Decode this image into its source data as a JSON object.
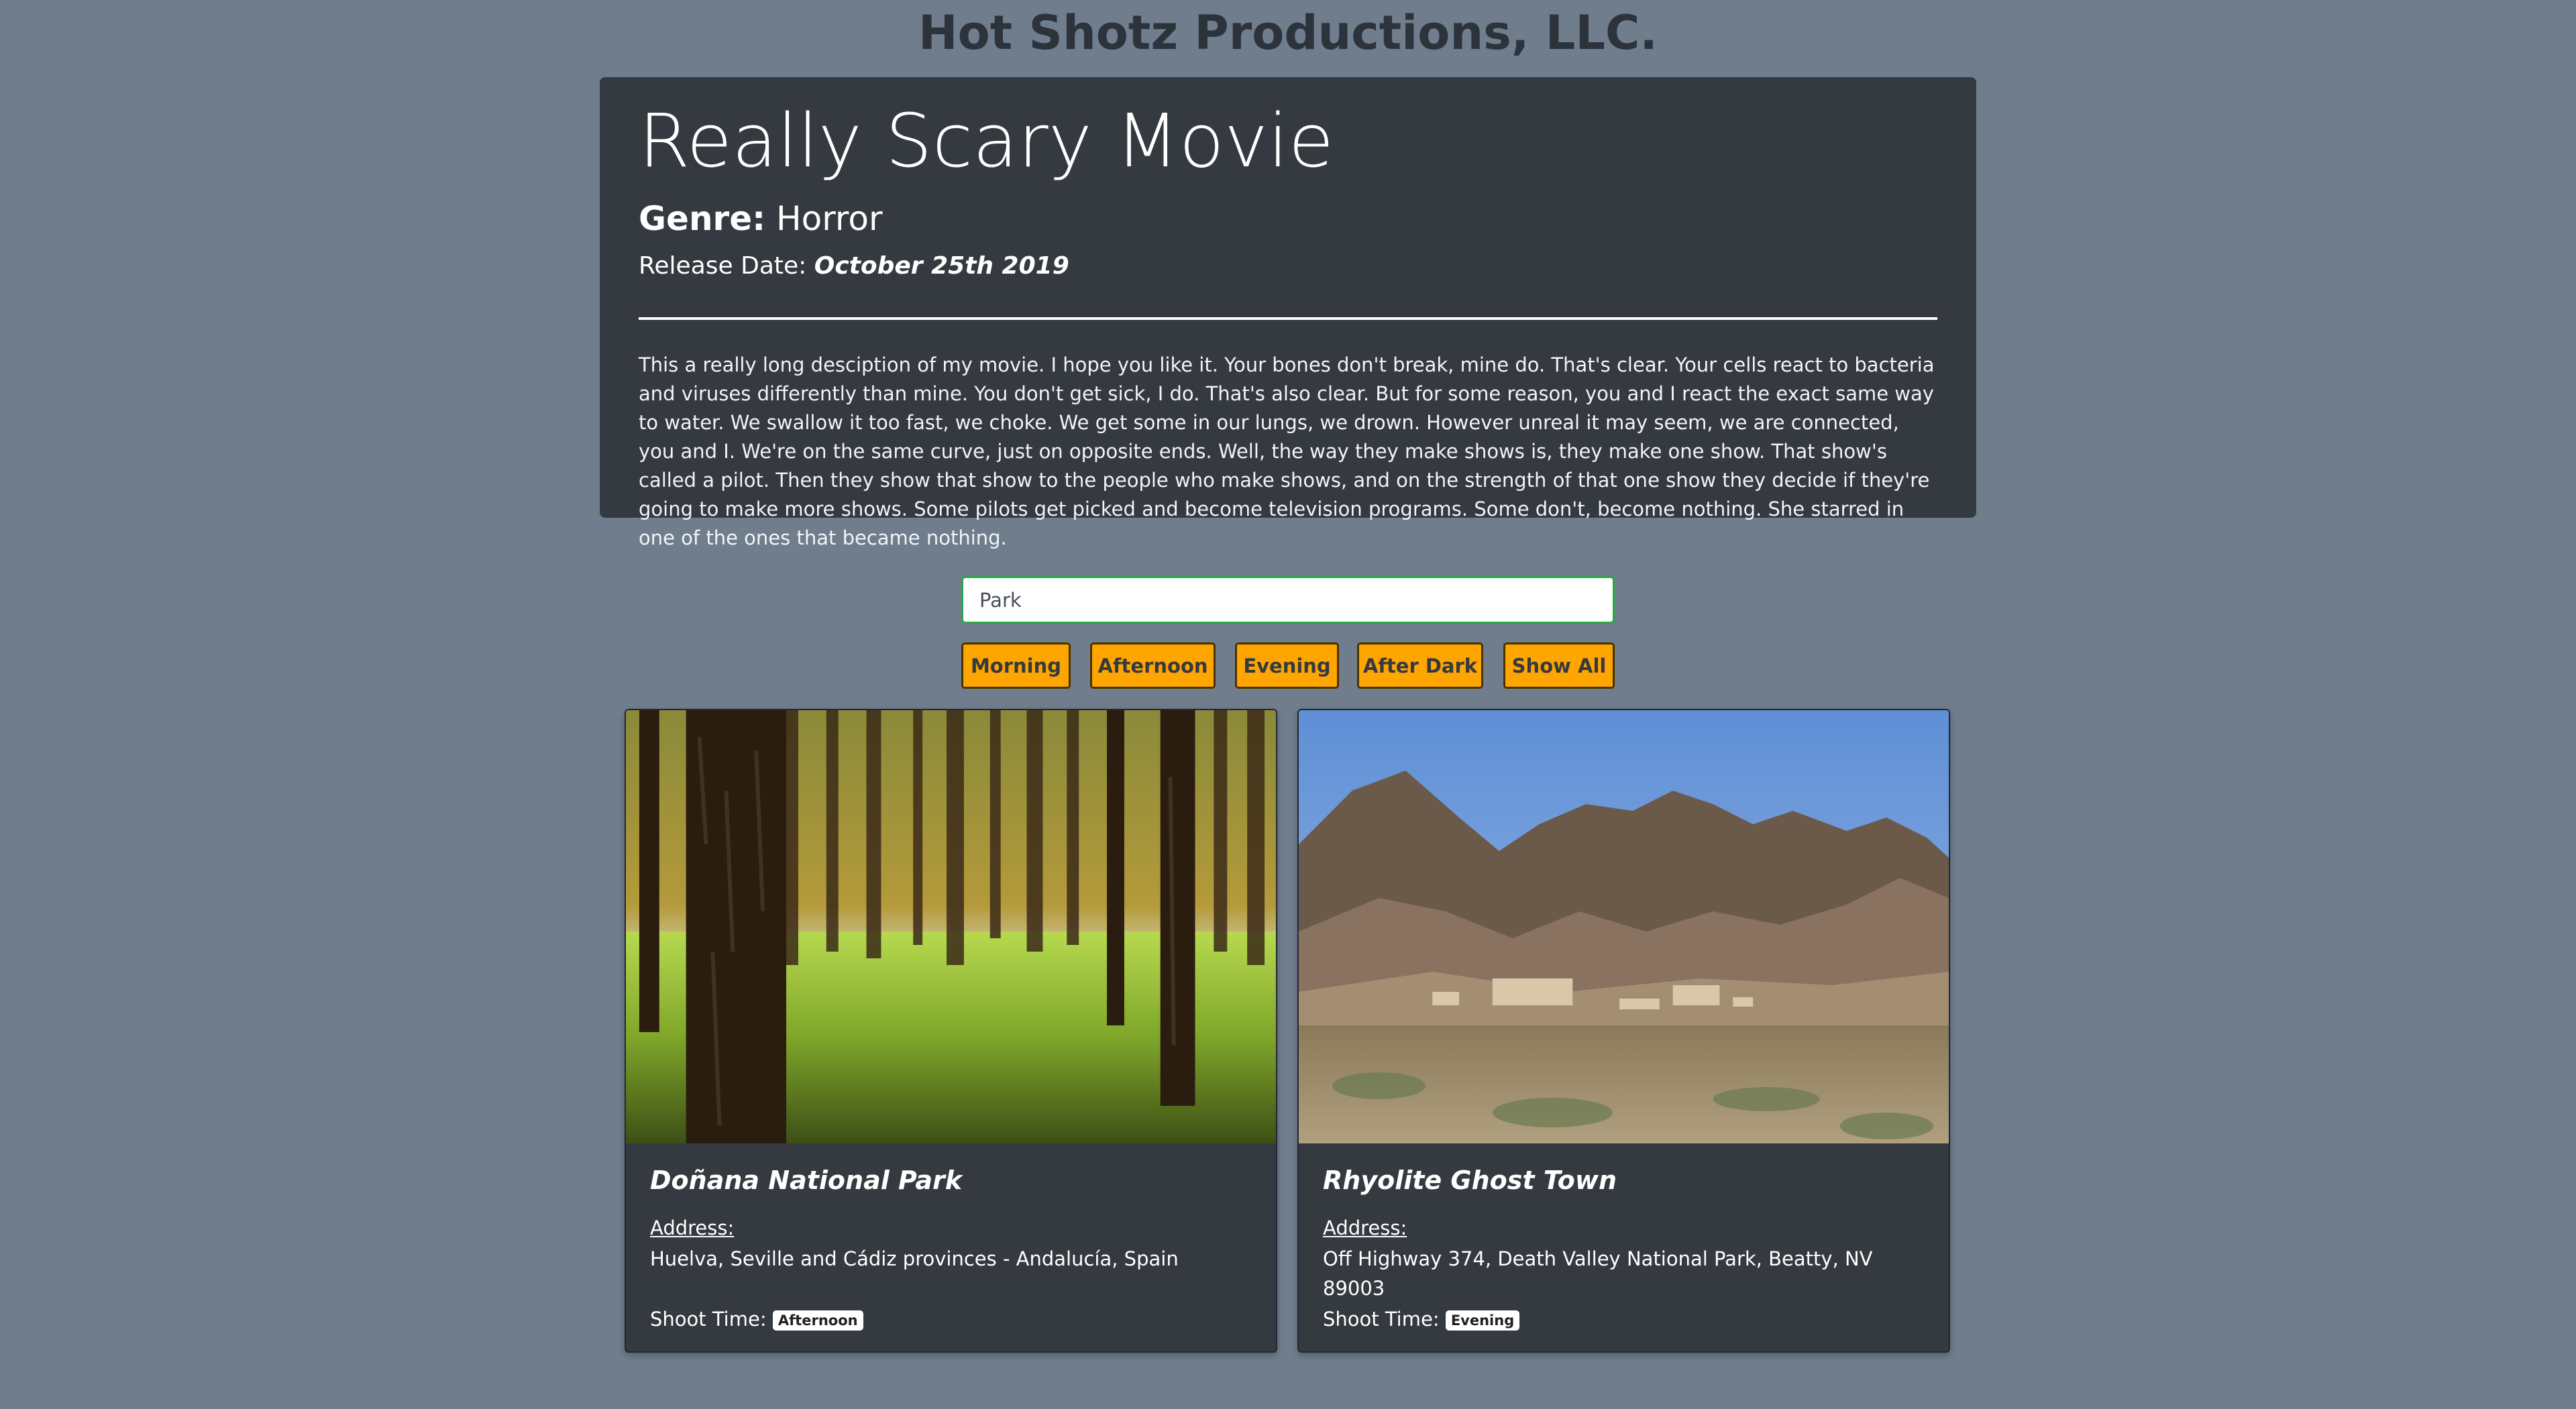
{
  "site": {
    "title": "Hot Shotz Productions, LLC."
  },
  "movie": {
    "title": "Really Scary Movie",
    "genre_label": "Genre:",
    "genre": "Horror",
    "release_label": "Release Date:",
    "release_date": "October 25th 2019",
    "description": "This a really long desciption of my movie. I hope you like it. Your bones don't break, mine do. That's clear. Your cells react to bacteria and viruses differently than mine. You don't get sick, I do. That's also clear. But for some reason, you and I react the exact same way to water. We swallow it too fast, we choke. We get some in our lungs, we drown. However unreal it may seem, we are connected, you and I. We're on the same curve, just on opposite ends. Well, the way they make shows is, they make one show. That show's called a pilot. Then they show that show to the people who make shows, and on the strength of that one show they decide if they're going to make more shows. Some pilots get picked and become television programs. Some don't, become nothing. She starred in one of the ones that became nothing."
  },
  "search": {
    "value": "Park"
  },
  "filters": {
    "morning": "Morning",
    "afternoon": "Afternoon",
    "evening": "Evening",
    "after_dark": "After Dark",
    "show_all": "Show All"
  },
  "locations": [
    {
      "name": "Doñana National Park",
      "address_label": "Address:",
      "address": "Huelva, Seville and Cádiz provinces - Andalucía, Spain",
      "shoot_label": "Shoot Time:",
      "shoot_time": "Afternoon",
      "image": "forest-photo"
    },
    {
      "name": "Rhyolite Ghost Town",
      "address_label": "Address:",
      "address": "Off Highway 374, Death Valley National Park, Beatty, NV 89003",
      "shoot_label": "Shoot Time:",
      "shoot_time": "Evening",
      "image": "desert-mountains-photo"
    }
  ],
  "colors": {
    "page_bg": "#6f7d8d",
    "panel_bg": "#343a40",
    "button_bg": "#ffa500",
    "input_border": "#28a745"
  }
}
